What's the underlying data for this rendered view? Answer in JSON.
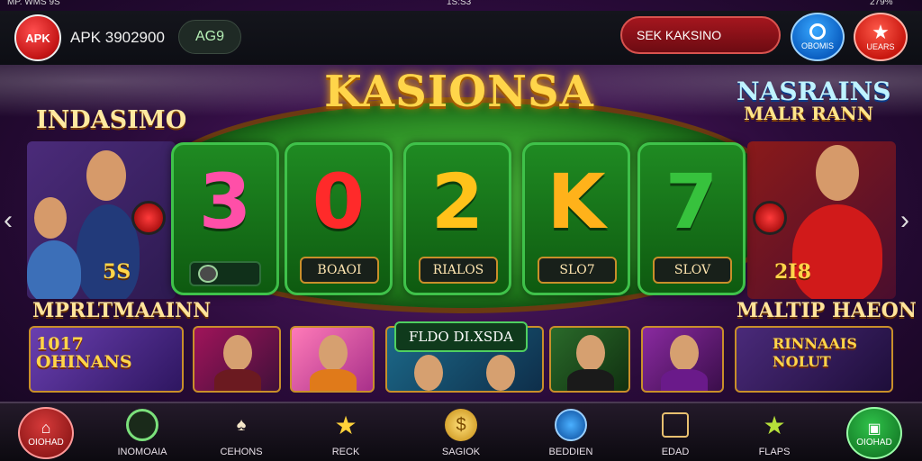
{
  "statusbar": {
    "left": "MP. WMS 9S",
    "center": "1S:S3",
    "right": "279%"
  },
  "topbar": {
    "logo_label": "APK",
    "app_title": "APK 3902900",
    "chip": "AG9",
    "search_label": "SEK KAKSINO",
    "blue_button_label": "OBOMIS",
    "red_button_label": "UEARS"
  },
  "stage": {
    "brand_title": "KASIONSA",
    "left_title": "INDASIMO",
    "right_logo_line1": "NASRAINS",
    "right_logo_line2": "MALR RANN"
  },
  "reels": [
    {
      "symbol": "3",
      "label": "",
      "color": "#ff4fa8"
    },
    {
      "symbol": "0",
      "label": "BOAOI",
      "color": "#ff2a2a"
    },
    {
      "symbol": "2",
      "label": "RIALOS",
      "color": "#ffc21a"
    },
    {
      "symbol": "K",
      "label": "SLO7",
      "color": "#ffb21a"
    },
    {
      "symbol": "7",
      "label": "SLOV",
      "color": "#37c23d"
    }
  ],
  "heroes": {
    "left_amount": "5S",
    "right_amount": "2I8"
  },
  "sections": {
    "left": "MPRLTMAAINN",
    "right": "MALTIP HAEON"
  },
  "tiles": {
    "first_tag_line1": "1017",
    "first_tag_line2": "OHINANS",
    "featured_banner": "FLDO DI.XSDA",
    "last_tag_line1": "RINNAAIS",
    "last_tag_line2": "NOLUT"
  },
  "bottomnav": {
    "items": [
      {
        "label": "OIOHAD",
        "icon": "home-icon"
      },
      {
        "label": "INOMOAIA",
        "icon": "circle-icon"
      },
      {
        "label": "CEHONS",
        "icon": "spade-icon"
      },
      {
        "label": "RECK",
        "icon": "star-icon"
      },
      {
        "label": "SAGIOK",
        "icon": "coin-icon"
      },
      {
        "label": "BEDDIEN",
        "icon": "globe-icon"
      },
      {
        "label": "EDAD",
        "icon": "box-icon"
      },
      {
        "label": "FLAPS",
        "icon": "star-icon"
      },
      {
        "label": "OIOHAD",
        "icon": "gift-icon"
      }
    ]
  }
}
